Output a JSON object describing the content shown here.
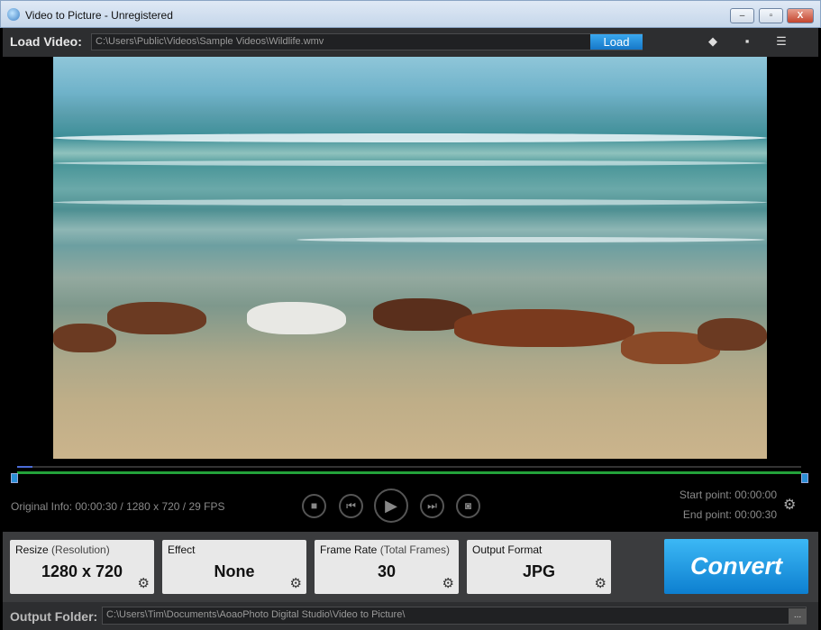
{
  "window": {
    "title": "Video to Picture - Unregistered",
    "minimize": "–",
    "maximize": "▫",
    "close": "X"
  },
  "toolbar": {
    "load_label": "Load Video:",
    "path": "C:\\Users\\Public\\Videos\\Sample Videos\\Wildlife.wmv",
    "load_button": "Load",
    "icons": [
      "tag-icon",
      "comment-icon",
      "register-icon"
    ]
  },
  "player": {
    "info": "Original Info: 00:00:30 / 1280 x 720 / 29 FPS",
    "start_point": "Start point: 00:00:00",
    "end_point": "End point: 00:00:30",
    "progress": 0.02
  },
  "settings": [
    {
      "title": "Resize",
      "sub": "(Resolution)",
      "value": "1280 x 720"
    },
    {
      "title": "Effect",
      "sub": "",
      "value": "None"
    },
    {
      "title": "Frame Rate",
      "sub": "(Total Frames)",
      "value": "30"
    },
    {
      "title": "Output Format",
      "sub": "",
      "value": "JPG"
    }
  ],
  "convert_label": "Convert",
  "output": {
    "label": "Output Folder:",
    "path": "C:\\Users\\Tim\\Documents\\AoaoPhoto Digital Studio\\Video to Picture\\",
    "browse": "..."
  }
}
